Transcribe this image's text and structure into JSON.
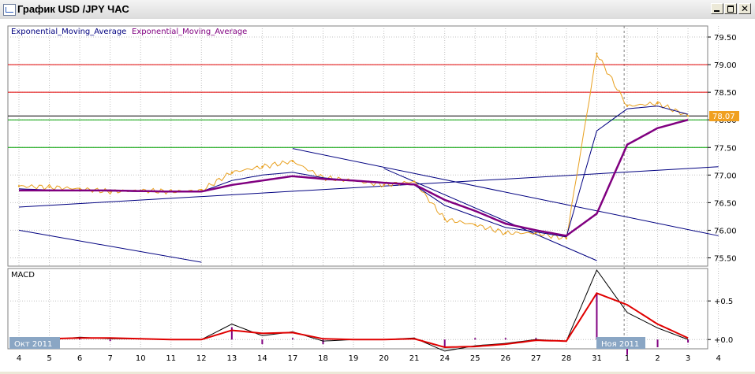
{
  "window": {
    "title": "График USD /JPY ЧАС",
    "buttons": [
      "minimize",
      "maximize",
      "close"
    ]
  },
  "price_pane": {
    "legend": [
      "Exponential_Moving_Average",
      "Exponential_Moving_Average"
    ],
    "current_price": "78.07",
    "y_ticks": [
      "79.50",
      "79.00",
      "78.50",
      "78.00",
      "77.50",
      "77.00",
      "76.50",
      "76.00",
      "75.50"
    ]
  },
  "macd_pane": {
    "title": "MACD",
    "y_ticks": [
      "+0.5",
      "+0.0"
    ]
  },
  "x_axis": {
    "month_labels": [
      "Окт 2011",
      "Ноя 2011"
    ],
    "day_labels": [
      "4",
      "5",
      "6",
      "7",
      "10",
      "11",
      "12",
      "13",
      "14",
      "17",
      "18",
      "19",
      "20",
      "21",
      "24",
      "25",
      "26",
      "27",
      "28",
      "31",
      "1",
      "2",
      "3",
      "4"
    ]
  },
  "colors": {
    "price": "#e8a020",
    "ema_fast": "#000080",
    "ema_slow": "#800080",
    "red_levels": "#e00000",
    "green_levels": "#00a000",
    "trendlines": "#000080",
    "macd_signal": "#e00000",
    "macd_histogram": "#800080",
    "price_tag": "#f0a020"
  },
  "chart_data": [
    {
      "type": "line",
      "title": "",
      "ylim": [
        75.35,
        79.7
      ],
      "x": [
        "4",
        "5",
        "6",
        "7",
        "10",
        "11",
        "12",
        "13",
        "14",
        "17",
        "18",
        "19",
        "20",
        "21",
        "24",
        "25",
        "26",
        "27",
        "28",
        "31",
        "1",
        "2",
        "3"
      ],
      "series": [
        {
          "name": "",
          "values": [
            76.8,
            76.78,
            76.75,
            76.7,
            76.72,
            76.7,
            76.72,
            77.05,
            77.15,
            77.25,
            76.95,
            76.9,
            76.82,
            76.88,
            76.2,
            76.1,
            75.95,
            75.95,
            75.85,
            79.2,
            78.25,
            78.3,
            78.07
          ]
        }
      ],
      "ema_lines": [
        {
          "name": "Exponential_Moving_Average",
          "values": [
            76.75,
            76.73,
            76.72,
            76.71,
            76.7,
            76.7,
            76.7,
            76.9,
            77.0,
            77.05,
            76.95,
            76.9,
            76.85,
            76.82,
            76.45,
            76.25,
            76.05,
            75.97,
            75.88,
            77.8,
            78.2,
            78.25,
            78.1
          ]
        },
        {
          "name": "Exponential_Moving_Average",
          "values": [
            76.72,
            76.72,
            76.72,
            76.72,
            76.71,
            76.7,
            76.7,
            76.82,
            76.9,
            76.98,
            76.93,
            76.9,
            76.86,
            76.83,
            76.55,
            76.35,
            76.12,
            76.0,
            75.9,
            76.3,
            77.55,
            77.85,
            78.0
          ]
        }
      ],
      "horizontal_levels": {
        "red": [
          79.0,
          78.5
        ],
        "green": [
          78.0,
          77.5
        ],
        "black": [
          78.07
        ]
      },
      "trendlines": [
        {
          "from": [
            "4",
            76.42
          ],
          "to": [
            "4(Nov)",
            77.15
          ]
        },
        {
          "from": [
            "17",
            77.48
          ],
          "to": [
            "4(Nov)",
            75.9
          ]
        },
        {
          "from": [
            "20",
            77.12
          ],
          "to": [
            "31",
            75.45
          ]
        },
        {
          "from": [
            "4",
            76.0
          ],
          "to": [
            "12",
            75.42
          ]
        }
      ]
    },
    {
      "type": "line",
      "title": "MACD",
      "ylim": [
        -0.12,
        0.92
      ],
      "x": [
        "4",
        "5",
        "6",
        "7",
        "10",
        "11",
        "12",
        "13",
        "14",
        "17",
        "18",
        "19",
        "20",
        "21",
        "24",
        "25",
        "26",
        "27",
        "28",
        "31",
        "1",
        "2",
        "3"
      ],
      "series": [
        {
          "name": "",
          "values": [
            0.02,
            0.0,
            0.03,
            0.01,
            0.01,
            0.0,
            0.0,
            0.2,
            0.05,
            0.1,
            -0.02,
            0.0,
            0.0,
            0.02,
            -0.15,
            -0.08,
            -0.05,
            0.0,
            -0.02,
            0.9,
            0.35,
            0.15,
            0.0
          ]
        },
        {
          "name": "",
          "values": [
            0.02,
            0.01,
            0.02,
            0.02,
            0.01,
            0.0,
            0.0,
            0.12,
            0.08,
            0.09,
            0.01,
            0.0,
            0.0,
            0.01,
            -0.1,
            -0.09,
            -0.06,
            -0.01,
            -0.02,
            0.6,
            0.45,
            0.2,
            0.02
          ]
        }
      ]
    }
  ]
}
